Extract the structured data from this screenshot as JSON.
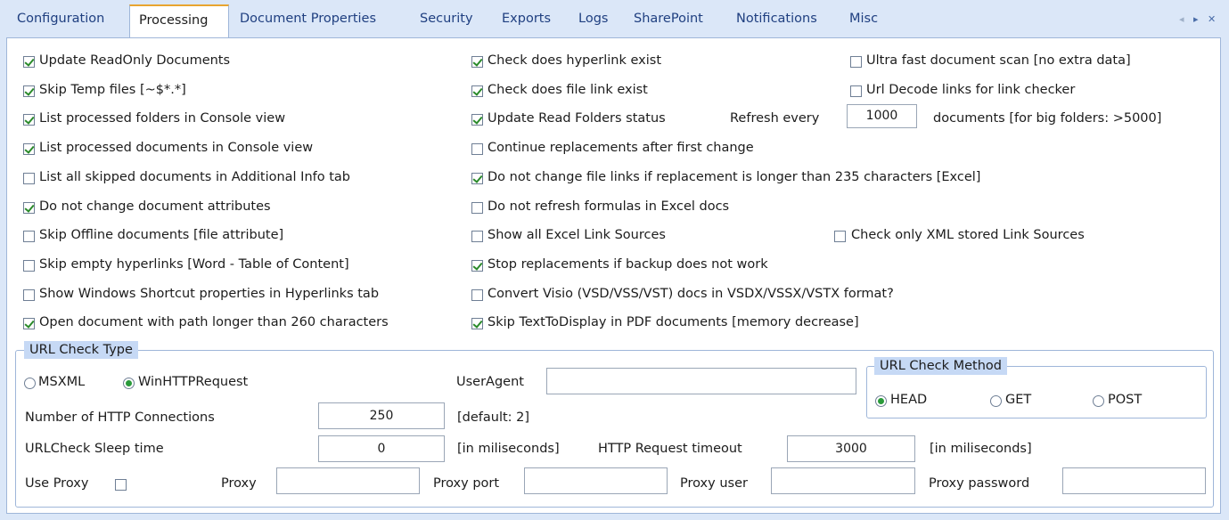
{
  "tabs": [
    "Configuration",
    "Processing",
    "Document Properties",
    "Security",
    "Exports",
    "Logs",
    "SharePoint",
    "Notifications",
    "Misc"
  ],
  "tab_nav": {
    "left": "◂",
    "right": "▸",
    "close": "✕"
  },
  "options_col1": [
    {
      "label": "Update ReadOnly Documents",
      "checked": true
    },
    {
      "label": "Skip Temp files [~$*.*]",
      "checked": true
    },
    {
      "label": "List processed folders in Console view",
      "checked": true
    },
    {
      "label": "List processed documents in Console view",
      "checked": true
    },
    {
      "label": "List all skipped documents in Additional Info tab",
      "checked": false
    },
    {
      "label": "Do not change document attributes",
      "checked": true
    },
    {
      "label": "Skip Offline documents [file attribute]",
      "checked": false
    },
    {
      "label": "Skip empty hyperlinks [Word - Table of Content]",
      "checked": false
    },
    {
      "label": "Show Windows Shortcut properties in Hyperlinks tab",
      "checked": false
    },
    {
      "label": "Open document with path longer than 260 characters",
      "checked": true
    }
  ],
  "options_col2": [
    {
      "label": "Check does hyperlink exist",
      "checked": true
    },
    {
      "label": "Check does file link exist",
      "checked": true
    },
    {
      "label": "Update Read Folders status",
      "checked": true
    },
    {
      "label": "Continue replacements after first change",
      "checked": false
    },
    {
      "label": "Do not change file links if replacement is longer than 235 characters [Excel]",
      "checked": true
    },
    {
      "label": "Do not refresh formulas in Excel docs",
      "checked": false
    },
    {
      "label": "Show all Excel Link Sources",
      "checked": false
    },
    {
      "label": "Stop replacements if backup does not work",
      "checked": true
    },
    {
      "label": "Convert Visio (VSD/VSS/VST) docs in VSDX/VSSX/VSTX format?",
      "checked": false
    },
    {
      "label": "Skip TextToDisplay in PDF documents [memory decrease]",
      "checked": true
    }
  ],
  "options_col3": [
    {
      "label": "Ultra fast document scan [no extra data]",
      "checked": false
    },
    {
      "label": "Url Decode links for link checker",
      "checked": false
    }
  ],
  "check_xml": {
    "label": "Check only XML stored Link Sources",
    "checked": false
  },
  "refresh": {
    "label": "Refresh every",
    "value": "1000",
    "suffix": "documents [for big folders: >5000]"
  },
  "url_check_type": {
    "legend": "URL Check Type",
    "radio_msxml": "MSXML",
    "radio_winhttp": "WinHTTPRequest",
    "selected": "WinHTTPRequest",
    "useragent_label": "UserAgent",
    "useragent_value": "",
    "connections_label": "Number of HTTP Connections",
    "connections_value": "250",
    "connections_default": "[default: 2]",
    "sleep_label": "URLCheck Sleep time",
    "sleep_value": "0",
    "sleep_unit": "[in miliseconds]",
    "timeout_label": "HTTP Request timeout",
    "timeout_value": "3000",
    "timeout_unit": "[in miliseconds]",
    "use_proxy_label": "Use Proxy",
    "use_proxy_checked": false,
    "proxy_label": "Proxy",
    "proxy_port_label": "Proxy port",
    "proxy_user_label": "Proxy user",
    "proxy_password_label": "Proxy password"
  },
  "url_check_method": {
    "legend": "URL Check Method",
    "options": [
      "HEAD",
      "GET",
      "POST"
    ],
    "selected": "HEAD"
  }
}
